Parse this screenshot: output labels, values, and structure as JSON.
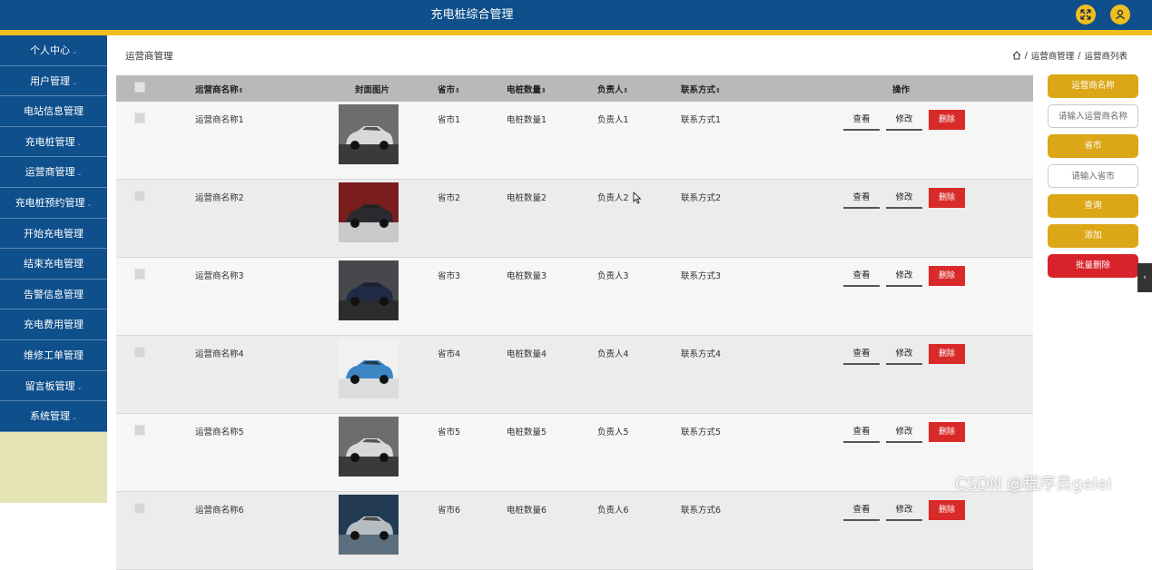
{
  "header": {
    "title": "充电桩综合管理",
    "fullscreen_icon": "expand-arrows-icon",
    "user_icon": "user-icon",
    "colors": {
      "bar": "#0e4f8c",
      "accent": "#f0be1e"
    }
  },
  "sidebar": {
    "items": [
      {
        "label": "个人中心"
      },
      {
        "label": "用户管理"
      },
      {
        "label": "电站信息管理"
      },
      {
        "label": "充电桩管理"
      },
      {
        "label": "运营商管理"
      },
      {
        "label": "充电桩预约管理"
      },
      {
        "label": "开始充电管理"
      },
      {
        "label": "结束充电管理"
      },
      {
        "label": "告警信息管理"
      },
      {
        "label": "充电费用管理"
      },
      {
        "label": "维修工单管理"
      },
      {
        "label": "留言板管理"
      },
      {
        "label": "系统管理"
      }
    ]
  },
  "page": {
    "title": "运营商管理",
    "breadcrumb": [
      "运营商管理",
      "运营商列表"
    ],
    "breadcrumb_sep": "/"
  },
  "table": {
    "headers": {
      "name": "运营商名称",
      "image": "封面图片",
      "province": "省市",
      "count": "电桩数量",
      "owner": "负责人",
      "contact": "联系方式",
      "ops": "操作"
    },
    "sort_glyph": "⇕",
    "actions": {
      "view": "查看",
      "edit": "修改",
      "delete": "删除"
    },
    "rows": [
      {
        "name": "运营商名称1",
        "image": "white-suv",
        "province": "省市1",
        "count": "电桩数量1",
        "owner": "负责人1",
        "contact": "联系方式1"
      },
      {
        "name": "运营商名称2",
        "image": "dark-car-showroom",
        "province": "省市2",
        "count": "电桩数量2",
        "owner": "负责人2",
        "contact": "联系方式2"
      },
      {
        "name": "运营商名称3",
        "image": "dark-blue-ev",
        "province": "省市3",
        "count": "电桩数量3",
        "owner": "负责人3",
        "contact": "联系方式3"
      },
      {
        "name": "运营商名称4",
        "image": "blue-small-car",
        "province": "省市4",
        "count": "电桩数量4",
        "owner": "负责人4",
        "contact": "联系方式4"
      },
      {
        "name": "运营商名称5",
        "image": "white-suv",
        "province": "省市5",
        "count": "电桩数量5",
        "owner": "负责人5",
        "contact": "联系方式5"
      },
      {
        "name": "运营商名称6",
        "image": "silver-sedan",
        "province": "省市6",
        "count": "电桩数量6",
        "owner": "负责人6",
        "contact": "联系方式6"
      }
    ]
  },
  "search": {
    "name_label": "运营商名称",
    "name_placeholder": "请输入运营商名称",
    "province_label": "省市",
    "province_placeholder": "请输入省市",
    "query": "查询",
    "add": "添加",
    "batch_delete": "批量删除"
  },
  "watermark": "CSDN @程序员gelei"
}
